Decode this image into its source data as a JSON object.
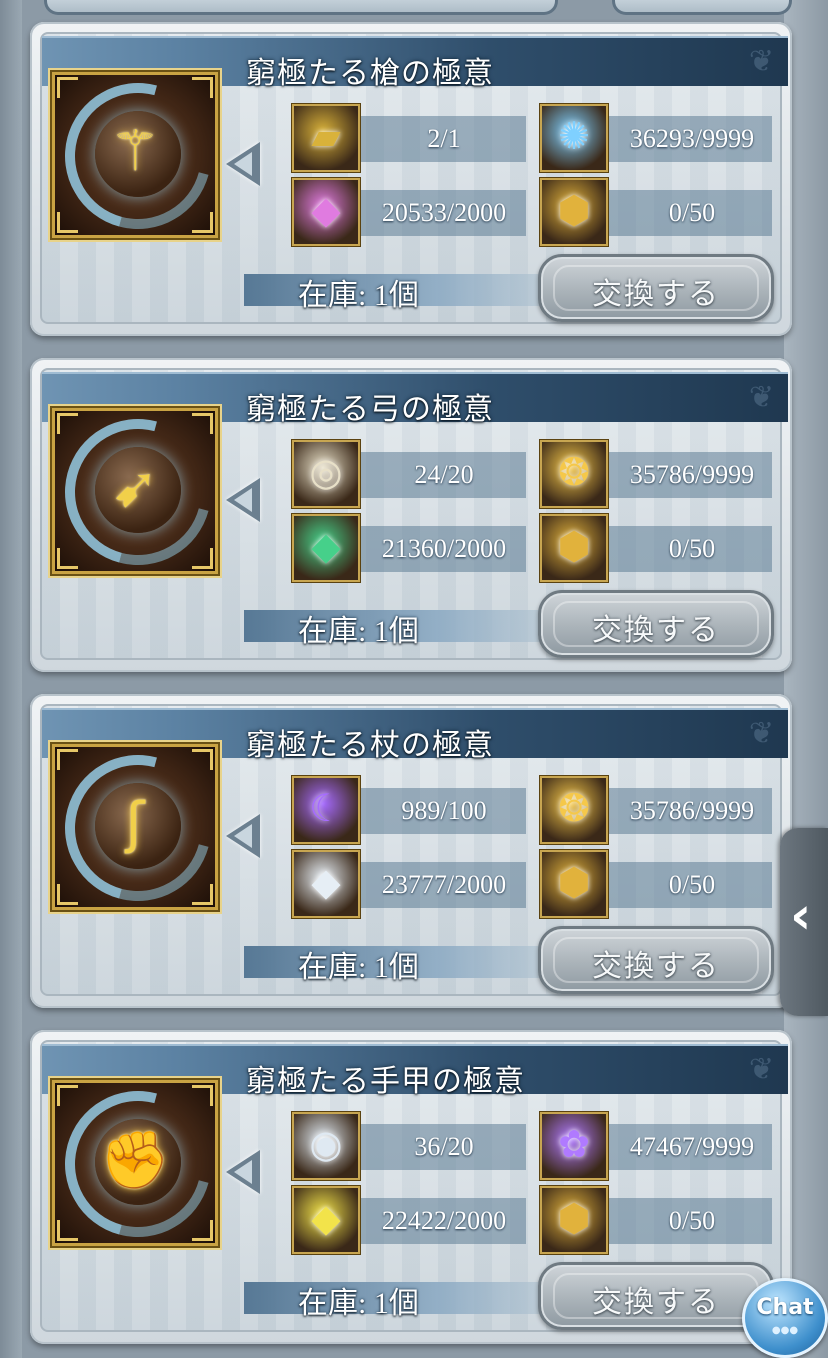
{
  "panels": [
    {
      "title": "窮極たる槍の極意",
      "weapon_icon": "spear-icon",
      "weapon_glyph": "⚚",
      "requirements": [
        {
          "icon": "gold-brick-icon",
          "glyph": "▰",
          "color": "#d9b23a",
          "count": "2/1"
        },
        {
          "icon": "blue-crystal-icon",
          "glyph": "✺",
          "color": "#7fd0ff",
          "count": "36293/9999"
        },
        {
          "icon": "pink-shard-icon",
          "glyph": "◆",
          "color": "#e07be0",
          "count": "20533/2000"
        },
        {
          "icon": "gold-medal-icon",
          "glyph": "⬢",
          "color": "#e1b23c",
          "count": "0/50"
        }
      ],
      "stock": "在庫: 1個",
      "exchange_label": "交換する"
    },
    {
      "title": "窮極たる弓の極意",
      "weapon_icon": "bow-icon",
      "weapon_glyph": "➹",
      "requirements": [
        {
          "icon": "clock-orb-icon",
          "glyph": "◎",
          "color": "#e8e0c8",
          "count": "24/20"
        },
        {
          "icon": "golden-flame-icon",
          "glyph": "❂",
          "color": "#f5c84a",
          "count": "35786/9999"
        },
        {
          "icon": "green-shard-icon",
          "glyph": "◆",
          "color": "#46d08a",
          "count": "21360/2000"
        },
        {
          "icon": "gold-medal-icon",
          "glyph": "⬢",
          "color": "#e1b23c",
          "count": "0/50"
        }
      ],
      "stock": "在庫: 1個",
      "exchange_label": "交換する"
    },
    {
      "title": "窮極たる杖の極意",
      "weapon_icon": "staff-icon",
      "weapon_glyph": "ʃ",
      "requirements": [
        {
          "icon": "purple-scythe-icon",
          "glyph": "☾",
          "color": "#a66bff",
          "count": "989/100"
        },
        {
          "icon": "golden-flame-icon",
          "glyph": "❂",
          "color": "#f5c84a",
          "count": "35786/9999"
        },
        {
          "icon": "white-shard-icon",
          "glyph": "◆",
          "color": "#e6eef5",
          "count": "23777/2000"
        },
        {
          "icon": "gold-medal-icon",
          "glyph": "⬢",
          "color": "#e1b23c",
          "count": "0/50"
        }
      ],
      "stock": "在庫: 1個",
      "exchange_label": "交換する"
    },
    {
      "title": "窮極たる手甲の極意",
      "weapon_icon": "gauntlet-icon",
      "weapon_glyph": "✊",
      "requirements": [
        {
          "icon": "orb-creature-icon",
          "glyph": "◉",
          "color": "#dfe9f2",
          "count": "36/20"
        },
        {
          "icon": "purple-rose-icon",
          "glyph": "✿",
          "color": "#b07aff",
          "count": "47467/9999"
        },
        {
          "icon": "yellow-shard-icon",
          "glyph": "◆",
          "color": "#f2e34a",
          "count": "22422/2000"
        },
        {
          "icon": "gold-medal-icon",
          "glyph": "⬢",
          "color": "#e1b23c",
          "count": "0/50"
        }
      ],
      "stock": "在庫: 1個",
      "exchange_label": "交換する"
    }
  ],
  "side_handle_icon": "chevron-left-icon",
  "chat": {
    "label": "Chat",
    "dots": "●●●"
  }
}
